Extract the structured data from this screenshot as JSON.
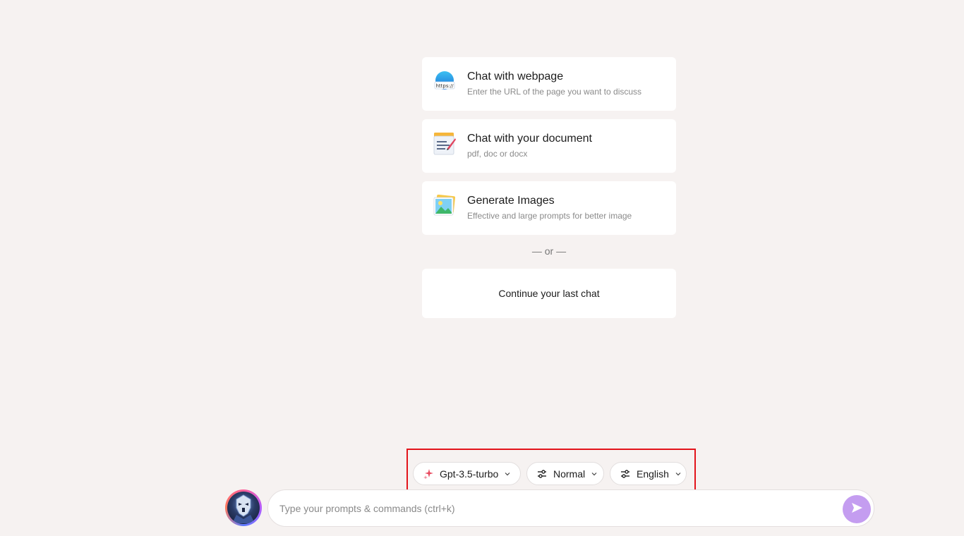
{
  "options": [
    {
      "title": "Chat with webpage",
      "subtitle": "Enter the URL of the page you want to discuss",
      "icon": "globe-https-icon",
      "icon_text": "https://"
    },
    {
      "title": "Chat with your document",
      "subtitle": "pdf, doc or docx",
      "icon": "document-pen-icon"
    },
    {
      "title": "Generate Images",
      "subtitle": "Effective and large prompts for better image",
      "icon": "image-icon"
    }
  ],
  "divider": "— or —",
  "continue_label": "Continue your last chat",
  "selectors": {
    "model": {
      "value": "Gpt-3.5-turbo",
      "icon": "sparkle-icon"
    },
    "mode": {
      "value": "Normal",
      "icon": "sliders-icon"
    },
    "language": {
      "value": "English",
      "icon": "sliders-icon"
    }
  },
  "prompt": {
    "placeholder": "Type your prompts & commands (ctrl+k)",
    "value": ""
  },
  "colors": {
    "background": "#f6f2f1",
    "accent": "#c49df0",
    "highlight": "#e3141b",
    "sparkle": "#e84a5f"
  }
}
